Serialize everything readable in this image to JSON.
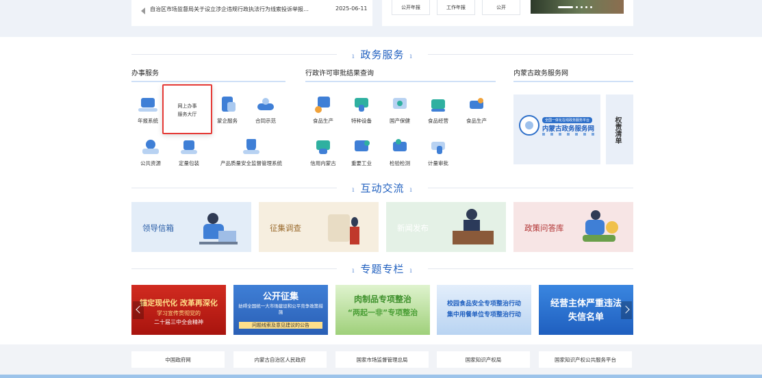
{
  "top": {
    "news_text": "自治区市场监督局关于设立涉企违规行政执法行为线索投诉举报…",
    "news_date": "2025-06-11",
    "public_buttons": [
      "公开年报",
      "工作年报",
      "公开"
    ]
  },
  "sections": {
    "gov_services": "政务服务",
    "interaction": "互动交流",
    "special": "专题专栏"
  },
  "gov_columns": {
    "left": "办事服务",
    "middle": "行政许可审批结果查询",
    "right": "内蒙古政务服务网"
  },
  "left_services": [
    "年报系统",
    "蒙企服务",
    "合同示范",
    "公共资源",
    "定量包装",
    "产品质量安全监督管理系统"
  ],
  "popup": {
    "line1": "网上办事",
    "line2": "服务大厅"
  },
  "middle_services": [
    "食品生产",
    "特种设备",
    "国产保健",
    "食品经营",
    "食品生产",
    "信用内蒙古",
    "重要工业",
    "检验检测",
    "计量审批"
  ],
  "gov_portal": {
    "tag": "全国一体化在线政务服务平台",
    "name": "内蒙古政务服务网",
    "power_list": "权责清单"
  },
  "interaction_cards": [
    {
      "label": "领导信箱",
      "bg": "#e3edf8",
      "color": "#2b5fa8"
    },
    {
      "label": "征集调查",
      "bg": "#f6eedf",
      "color": "#9a6b2e"
    },
    {
      "label": "新闻发布",
      "bg": "#e4f1e6",
      "color": "#ffffff"
    },
    {
      "label": "政策问答库",
      "bg": "#f7e5e5",
      "color": "#b03030"
    }
  ],
  "special_banners": [
    {
      "line1": "锚定现代化 改革再深化",
      "line2": "学习宣传贯彻党的",
      "line3": "二十届三中全会精神"
    },
    {
      "line1": "公开征集",
      "line2": "妨碍全国统一大市场建设和公平竞争政策措施",
      "line3": "问题线索及意见建议的公告"
    },
    {
      "line1": "肉制品专项整治",
      "line2": "“两起一非”专项整治",
      "line3": ""
    },
    {
      "line1": "校园食品安全专项整治行动",
      "line2": "集中用餐单位专项整治行动",
      "line3": ""
    },
    {
      "line1": "经营主体严重违法",
      "line2": "失信名单",
      "line3": ""
    }
  ],
  "footer_links": [
    "中国政府网",
    "内蒙古自治区人民政府",
    "国家市场监督管理总局",
    "国家知识产权局",
    "国家知识产权公共服务平台"
  ]
}
